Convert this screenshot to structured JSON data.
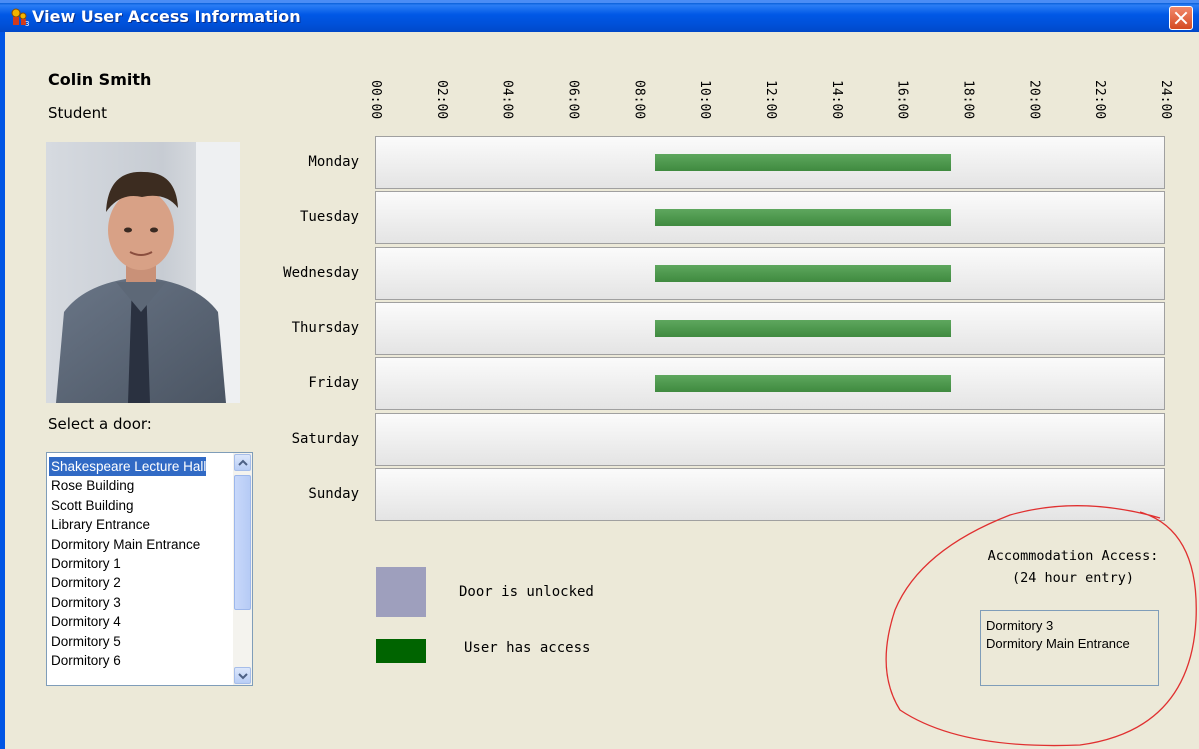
{
  "window": {
    "title": "View User Access Information"
  },
  "user": {
    "name": "Colin Smith",
    "role": "Student"
  },
  "door_selector": {
    "label": "Select a door:",
    "selected": "Shakespeare Lecture Hall",
    "items": [
      "Shakespeare Lecture Hall",
      "Rose Building",
      "Scott Building",
      "Library Entrance",
      "Dormitory Main Entrance",
      "Dormitory 1",
      "Dormitory 2",
      "Dormitory 3",
      "Dormitory 4",
      "Dormitory 5",
      "Dormitory 6"
    ]
  },
  "schedule": {
    "time_labels": [
      "00:00",
      "02:00",
      "04:00",
      "06:00",
      "08:00",
      "10:00",
      "12:00",
      "14:00",
      "16:00",
      "18:00",
      "20:00",
      "22:00",
      "24:00"
    ],
    "days": [
      {
        "label": "Monday",
        "access": [
          [
            8.5,
            17.5
          ]
        ]
      },
      {
        "label": "Tuesday",
        "access": [
          [
            8.5,
            17.5
          ]
        ]
      },
      {
        "label": "Wednesday",
        "access": [
          [
            8.5,
            17.5
          ]
        ]
      },
      {
        "label": "Thursday",
        "access": [
          [
            8.5,
            17.5
          ]
        ]
      },
      {
        "label": "Friday",
        "access": [
          [
            8.5,
            17.5
          ]
        ]
      },
      {
        "label": "Saturday",
        "access": []
      },
      {
        "label": "Sunday",
        "access": []
      }
    ]
  },
  "legend": {
    "unlocked": {
      "label": "Door is unlocked",
      "color": "#9e9fbd"
    },
    "access": {
      "label": "User has access",
      "color": "#006400"
    }
  },
  "accommodation": {
    "title_line1": "Accommodation Access:",
    "title_line2": "(24 hour entry)",
    "items": [
      "Dormitory 3",
      "Dormitory Main Entrance"
    ]
  },
  "colors": {
    "titlebar": "#0058e6",
    "selection": "#316ac5",
    "access_bar": "#4a944a",
    "annotation_circle": "#e03030"
  }
}
